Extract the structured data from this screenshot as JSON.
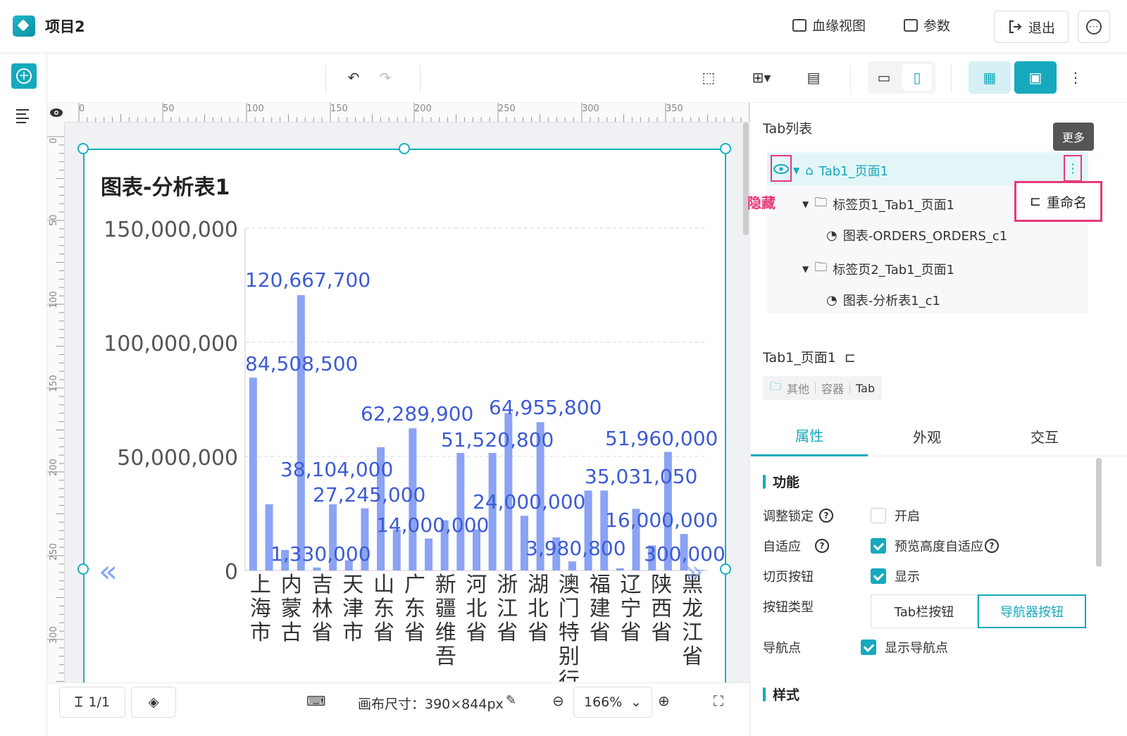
{
  "header": {
    "project_title": "项目2",
    "lineage_label": "血缘视图",
    "params_label": "参数",
    "exit_label": "退出"
  },
  "canvas": {
    "ruler_top": [
      "0",
      "50",
      "100",
      "150",
      "200",
      "250",
      "300",
      "350"
    ],
    "ruler_left": [
      "0",
      "50",
      "100",
      "150",
      "200",
      "250",
      "300"
    ],
    "nav_prev": "«",
    "nav_next": "»"
  },
  "chart_data": {
    "type": "bar",
    "title": "图表-分析表1",
    "categories": [
      "上海市",
      "内蒙古",
      "吉林省",
      "天津市",
      "山东省",
      "广东省",
      "新疆维吾",
      "河北省",
      "浙江省",
      "湖北省",
      "澳门特别行",
      "福建省",
      "辽宁省",
      "陕西省",
      "黑龙江省"
    ],
    "values": [
      84508500,
      29000000,
      9000000,
      120667700,
      1330000,
      29000000,
      4500000,
      27245000,
      54000000,
      18000000,
      62289900,
      14000000,
      22000000,
      51520800,
      18000000,
      51520800,
      69000000,
      24000000,
      64955800,
      14500000,
      3980800,
      35031050,
      35031050,
      1000000,
      27000000,
      11000000,
      51960000,
      16000000,
      300000
    ],
    "data_labels": [
      "120,667,700",
      "84,508,500",
      "38,104,000",
      "27,245,000",
      "1,330,000",
      "62,289,900",
      "14,000,000",
      "51,520,800",
      "64,955,800",
      "24,000,000",
      "3,980,800",
      "51,960,000",
      "35,031,050",
      "16,000,000",
      "300,000"
    ],
    "ytick_labels": [
      "150,000,000",
      "100,000,000",
      "50,000,000",
      "0"
    ],
    "ylim": [
      0,
      150000000
    ],
    "grid": true,
    "colors": {
      "bar": "#8aa3f5",
      "label": "#3d5bd6"
    }
  },
  "bottombar": {
    "page_indicator": "1/1",
    "canvas_size_label": "画布尺寸：390×844px",
    "zoom_value": "166%"
  },
  "panel": {
    "tablist_title": "Tab列表",
    "tooltip": "更多",
    "hide_label": "隐藏",
    "rename_label": "重命名",
    "tree": [
      {
        "label": "Tab1_页面1",
        "level": 0
      },
      {
        "label": "标签页1_Tab1_页面1",
        "level": 1
      },
      {
        "label": "图表-ORDERS_ORDERS_c1",
        "level": 2
      },
      {
        "label": "标签页2_Tab1_页面1",
        "level": 1
      },
      {
        "label": "图表-分析表1_c1",
        "level": 2
      }
    ],
    "page_name": "Tab1_页面1",
    "type_tag": [
      "其他",
      "容器",
      "Tab"
    ],
    "tabs": [
      "属性",
      "外观",
      "交互"
    ],
    "section_function": "功能",
    "section_style": "样式",
    "props": {
      "lock_label": "调整锁定",
      "lock_value": "开启",
      "adaptive_label": "自适应",
      "adaptive_value": "预览高度自适应",
      "pager_label": "切页按钮",
      "pager_value": "显示",
      "btn_type_label": "按钮类型",
      "btn_type_opt1": "Tab栏按钮",
      "btn_type_opt2": "导航器按钮",
      "nav_dot_label": "导航点",
      "nav_dot_value": "显示导航点"
    }
  }
}
